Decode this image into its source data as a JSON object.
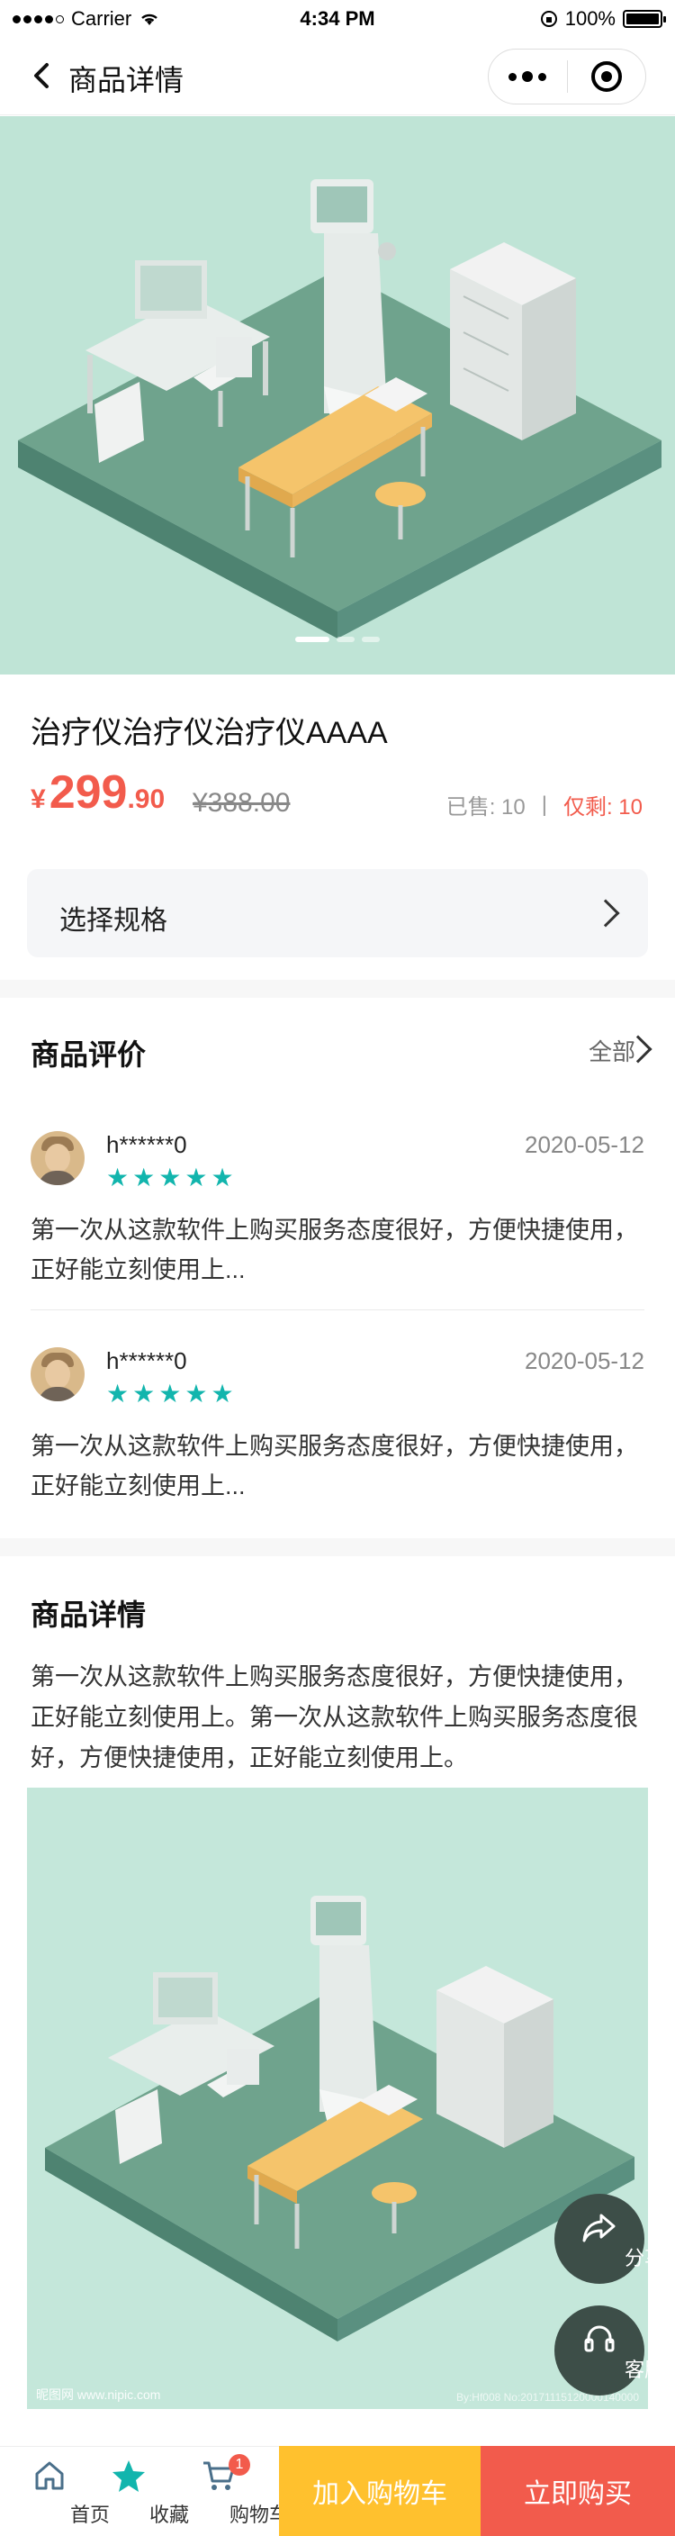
{
  "status_bar": {
    "carrier": "Carrier",
    "time": "4:34 PM",
    "battery": "100%"
  },
  "nav": {
    "title": "商品详情"
  },
  "banner": {
    "slide_count": 3,
    "active_index": 0
  },
  "product": {
    "title": "治疗仪治疗仪治疗仪AAAA",
    "price_symbol": "¥",
    "price_int": "299",
    "price_dec": ".90",
    "original_price": "¥388.00",
    "sold_label": "已售: 10",
    "separator": "|",
    "remaining_label": "仅剩: 10"
  },
  "spec": {
    "label": "选择规格"
  },
  "reviews": {
    "title": "商品评价",
    "all_label": "全部",
    "items": [
      {
        "user": "h******0",
        "date": "2020-05-12",
        "stars": 5,
        "text": "第一次从这款软件上购买服务态度很好，方便快捷使用，正好能立刻使用上..."
      },
      {
        "user": "h******0",
        "date": "2020-05-12",
        "stars": 5,
        "text": "第一次从这款软件上购买服务态度很好，方便快捷使用，正好能立刻使用上..."
      }
    ]
  },
  "detail": {
    "title": "商品详情",
    "text": "第一次从这款软件上购买服务态度很好，方便快捷使用，正好能立刻使用上。第一次从这款软件上购买服务态度很好，方便快捷使用，正好能立刻使用上。",
    "watermark_left": "昵图网 www.nipic.com",
    "watermark_right": "By:Hf008  No:20171115120000140000"
  },
  "floating": {
    "share_label": "分享",
    "service_label": "客服"
  },
  "tabbar": {
    "home_label": "首页",
    "fav_label": "收藏",
    "cart_label": "购物车",
    "cart_badge": "1",
    "add_cart_label": "加入购物车",
    "buy_now_label": "立即购买"
  },
  "colors": {
    "accent": "#f25b4c",
    "star": "#12b5ad",
    "cart_button": "#ffc12e",
    "floating": "#3d4e48"
  }
}
